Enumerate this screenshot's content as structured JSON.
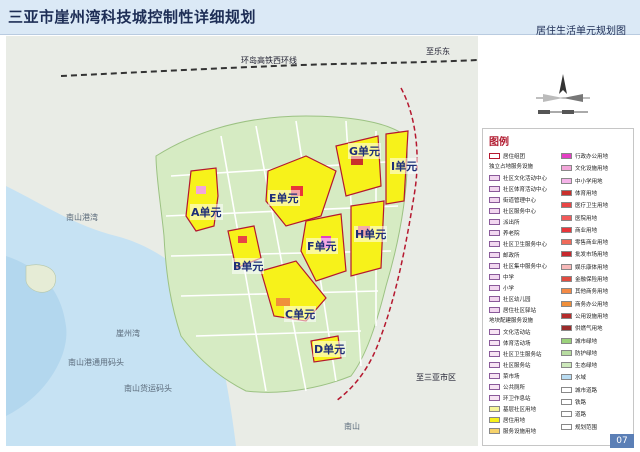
{
  "header": {
    "title": "三亚市崖州湾科技城控制性详细规划",
    "subtitle": "居住生活单元规划图"
  },
  "page_number": "07",
  "map": {
    "units": [
      {
        "id": "A",
        "label": "A单元"
      },
      {
        "id": "B",
        "label": "B单元"
      },
      {
        "id": "C",
        "label": "C单元"
      },
      {
        "id": "D",
        "label": "D单元"
      },
      {
        "id": "E",
        "label": "E单元"
      },
      {
        "id": "F",
        "label": "F单元"
      },
      {
        "id": "G",
        "label": "G单元"
      },
      {
        "id": "H",
        "label": "H单元"
      },
      {
        "id": "I",
        "label": "I单元"
      }
    ],
    "place_labels": {
      "railway": "环岛高铁西环线",
      "south_port": "南山港湾",
      "bay": "崖州湾",
      "port_a": "南山港通用码头",
      "port_b": "南山货运码头",
      "nanshan": "南山",
      "east_label": "至三亚市区",
      "top_right": "至乐东"
    }
  },
  "legend": {
    "title": "图例",
    "left_items": [
      {
        "label": "居住组团",
        "color": "#ffffff",
        "border": "#b5182f"
      },
      {
        "label": "独立占地服务设施",
        "color": "",
        "border": "",
        "section": true
      },
      {
        "label": "社区文化活动中心",
        "color": "#f2d7f0",
        "border": "#8a5a9a"
      },
      {
        "label": "社区体育活动中心",
        "color": "#f2d7f0",
        "border": "#8a5a9a"
      },
      {
        "label": "街道管理中心",
        "color": "#f2d7f0",
        "border": "#8a5a9a"
      },
      {
        "label": "社区服务中心",
        "color": "#f2d7f0",
        "border": "#8a5a9a"
      },
      {
        "label": "派出所",
        "color": "#f2d7f0",
        "border": "#8a5a9a"
      },
      {
        "label": "养老院",
        "color": "#f2d7f0",
        "border": "#8a5a9a"
      },
      {
        "label": "社区卫生服务中心",
        "color": "#f2d7f0",
        "border": "#8a5a9a"
      },
      {
        "label": "邮政所",
        "color": "#f2d7f0",
        "border": "#8a5a9a"
      },
      {
        "label": "社区集中服务中心",
        "color": "#f2d7f0",
        "border": "#8a5a9a"
      },
      {
        "label": "中学",
        "color": "#f2d7f0",
        "border": "#8a5a9a"
      },
      {
        "label": "小学",
        "color": "#f2d7f0",
        "border": "#8a5a9a"
      },
      {
        "label": "社区幼儿园",
        "color": "#f2d7f0",
        "border": "#8a5a9a"
      },
      {
        "label": "居住社区驿站",
        "color": "#f2d7f0",
        "border": "#8a5a9a"
      },
      {
        "label": "地块配建服务设施",
        "color": "",
        "border": "",
        "section": true
      },
      {
        "label": "文化活动站",
        "color": "#f7e4f3",
        "border": "#8a5a9a"
      },
      {
        "label": "体育活动场",
        "color": "#f7e4f3",
        "border": "#8a5a9a"
      },
      {
        "label": "社区卫生服务站",
        "color": "#f7e4f3",
        "border": "#8a5a9a"
      },
      {
        "label": "社区服务站",
        "color": "#f7e4f3",
        "border": "#8a5a9a"
      },
      {
        "label": "菜市场",
        "color": "#f7e4f3",
        "border": "#8a5a9a"
      },
      {
        "label": "公共厕所",
        "color": "#f7e4f3",
        "border": "#8a5a9a"
      },
      {
        "label": "环卫作息站",
        "color": "#f7e4f3",
        "border": "#8a5a9a"
      },
      {
        "label": "基层社区用地",
        "color": "#f6f69a",
        "border": "#888888"
      },
      {
        "label": "居住用地",
        "color": "#f7f21a",
        "border": "#888888"
      },
      {
        "label": "服务设施用地",
        "color": "#f6d26b",
        "border": "#888888"
      }
    ],
    "right_items": [
      {
        "label": "行政办公用地",
        "color": "#e43fc4"
      },
      {
        "label": "文化设施用地",
        "color": "#f3a6d9"
      },
      {
        "label": "中小学用地",
        "color": "#f5b3e8"
      },
      {
        "label": "体育用地",
        "color": "#c9302c"
      },
      {
        "label": "医疗卫生用地",
        "color": "#e84545"
      },
      {
        "label": "医院用地",
        "color": "#f25a5a"
      },
      {
        "label": "商业用地",
        "color": "#e9353a"
      },
      {
        "label": "零售商业用地",
        "color": "#f06a5a"
      },
      {
        "label": "批发市场用地",
        "color": "#c7282d"
      },
      {
        "label": "娱乐康体用地",
        "color": "#f7b9b9"
      },
      {
        "label": "金融保险用地",
        "color": "#e14b40"
      },
      {
        "label": "其他商务用地",
        "color": "#f48a45"
      },
      {
        "label": "商务办公用地",
        "color": "#f08f3a"
      },
      {
        "label": "公用设施用地",
        "color": "#b52c2c"
      },
      {
        "label": "供燃气用地",
        "color": "#9a2b2b"
      },
      {
        "label": "城市绿地",
        "color": "#9bd27b"
      },
      {
        "label": "防护绿地",
        "color": "#b7dca0"
      },
      {
        "label": "生态绿地",
        "color": "#cde8bb"
      },
      {
        "label": "水域",
        "color": "#b9dcf2"
      },
      {
        "label": "城市道路",
        "color": "#ffffff"
      },
      {
        "label": "铁路",
        "color": "#ffffff"
      },
      {
        "label": "道路",
        "color": "#ffffff"
      },
      {
        "label": "规划范围",
        "color": "#ffffff"
      }
    ]
  }
}
